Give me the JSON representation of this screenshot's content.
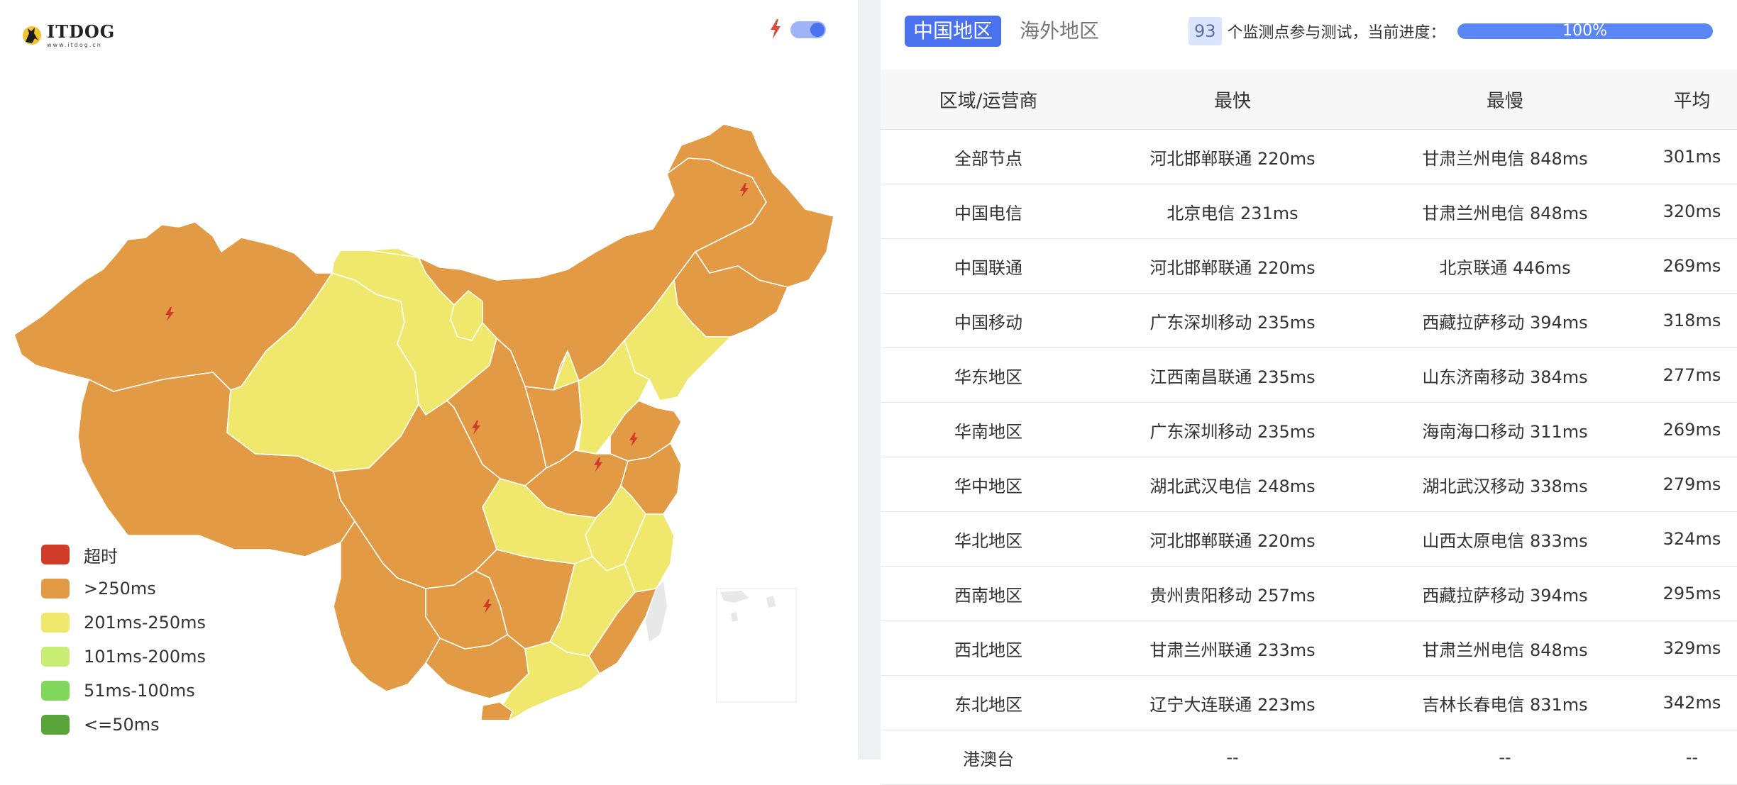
{
  "logo": {
    "name": "ITDOG",
    "url": "www.itdog.cn"
  },
  "map": {
    "live_toggle": {
      "on": true,
      "icon": "lightning-icon"
    },
    "legend": [
      {
        "label": "超时",
        "color": "#d13b2a"
      },
      {
        "label": ">250ms",
        "color": "#e39a45"
      },
      {
        "label": "201ms-250ms",
        "color": "#f0e86c"
      },
      {
        "label": "101ms-200ms",
        "color": "#c9ee74"
      },
      {
        "label": "51ms-100ms",
        "color": "#7fd65b"
      },
      {
        "label": "<=50ms",
        "color": "#5aa53a"
      }
    ],
    "colors": {
      "slow": "#e39a45",
      "medium": "#f0e86c",
      "marker": "#d13b2a",
      "islands": "#e8e8e8"
    }
  },
  "tabs": [
    {
      "label": "中国地区",
      "active": true
    },
    {
      "label": "海外地区",
      "active": false
    }
  ],
  "status": {
    "count": "93",
    "text": "个监测点参与测试，当前进度：",
    "progress_label": "100%",
    "progress_fraction": 1.0
  },
  "table": {
    "headers": [
      "区域/运营商",
      "最快",
      "最慢",
      "平均"
    ],
    "rows": [
      [
        "全部节点",
        "河北邯郸联通 220ms",
        "甘肃兰州电信 848ms",
        "301ms"
      ],
      [
        "中国电信",
        "北京电信 231ms",
        "甘肃兰州电信 848ms",
        "320ms"
      ],
      [
        "中国联通",
        "河北邯郸联通 220ms",
        "北京联通 446ms",
        "269ms"
      ],
      [
        "中国移动",
        "广东深圳移动 235ms",
        "西藏拉萨移动 394ms",
        "318ms"
      ],
      [
        "华东地区",
        "江西南昌联通 235ms",
        "山东济南移动 384ms",
        "277ms"
      ],
      [
        "华南地区",
        "广东深圳移动 235ms",
        "海南海口移动 311ms",
        "269ms"
      ],
      [
        "华中地区",
        "湖北武汉电信 248ms",
        "湖北武汉移动 338ms",
        "279ms"
      ],
      [
        "华北地区",
        "河北邯郸联通 220ms",
        "山西太原电信 833ms",
        "324ms"
      ],
      [
        "西南地区",
        "贵州贵阳移动 257ms",
        "西藏拉萨移动 394ms",
        "295ms"
      ],
      [
        "西北地区",
        "甘肃兰州联通 233ms",
        "甘肃兰州电信 848ms",
        "329ms"
      ],
      [
        "东北地区",
        "辽宁大连联通 223ms",
        "吉林长春电信 831ms",
        "342ms"
      ],
      [
        "港澳台",
        "--",
        "--",
        "--"
      ]
    ]
  }
}
